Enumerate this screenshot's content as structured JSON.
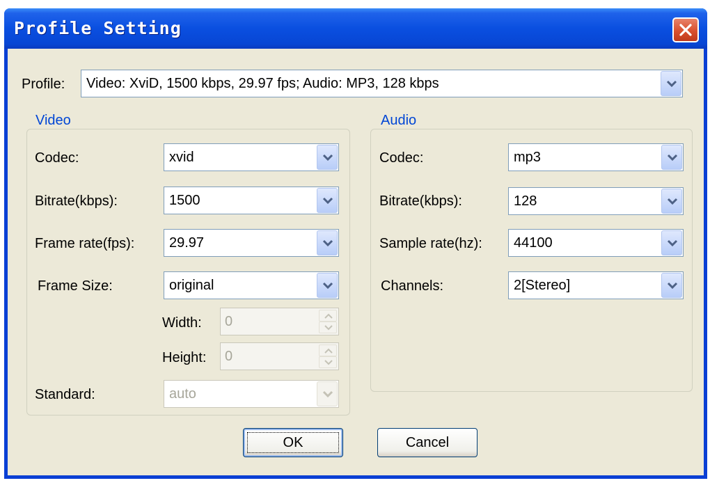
{
  "window": {
    "title": "Profile Setting"
  },
  "profile": {
    "label": "Profile:",
    "value": "Video: XviD, 1500 kbps, 29.97 fps;  Audio: MP3, 128 kbps"
  },
  "video": {
    "title": "Video",
    "codec": {
      "label": "Codec:",
      "value": "xvid"
    },
    "bitrate": {
      "label": "Bitrate(kbps):",
      "value": "1500"
    },
    "frame_rate": {
      "label": "Frame rate(fps):",
      "value": "29.97"
    },
    "frame_size": {
      "label": "Frame Size:",
      "value": "original"
    },
    "width": {
      "label": "Width:",
      "value": "0"
    },
    "height": {
      "label": "Height:",
      "value": "0"
    },
    "standard": {
      "label": "Standard:",
      "value": "auto"
    }
  },
  "audio": {
    "title": "Audio",
    "codec": {
      "label": "Codec:",
      "value": "mp3"
    },
    "bitrate": {
      "label": "Bitrate(kbps):",
      "value": "128"
    },
    "sample_rate": {
      "label": "Sample rate(hz):",
      "value": "44100"
    },
    "channels": {
      "label": "Channels:",
      "value": "2[Stereo]"
    }
  },
  "buttons": {
    "ok": "OK",
    "cancel": "Cancel"
  },
  "icons": {
    "close": "close-icon",
    "dropdown": "chevron-down-icon",
    "spin_up": "spin-up-icon",
    "spin_down": "spin-down-icon"
  },
  "colors": {
    "titlebar": "#0a4fe0",
    "dialog_background": "#ece9d8",
    "group_title": "#0046d5",
    "close_button": "#d9502e"
  }
}
